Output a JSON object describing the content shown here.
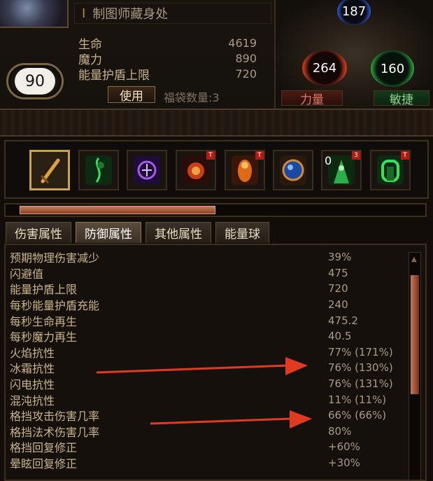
{
  "header": {
    "title": "制图师藏身处",
    "level": "90",
    "use_button": "使用",
    "bag_count": "福袋数量:3"
  },
  "stats": [
    {
      "label": "生命",
      "value": "4619"
    },
    {
      "label": "魔力",
      "value": "890"
    },
    {
      "label": "能量护盾上限",
      "value": "720"
    }
  ],
  "attributes": {
    "intelligence": "187",
    "strength": "264",
    "dexterity": "160",
    "strength_label": "力量",
    "dexterity_label": "敏捷"
  },
  "flasks": [
    {
      "name": "sword-icon",
      "color": "#d89a3a",
      "selected": true
    },
    {
      "name": "green-figure-icon",
      "color": "#2a9a3a"
    },
    {
      "name": "purple-rune-icon",
      "color": "#7a3ad0"
    },
    {
      "name": "fire-fist-icon",
      "color": "#d04a1a",
      "tag": "T"
    },
    {
      "name": "burning-figure-icon",
      "color": "#e0701a",
      "tag": "T"
    },
    {
      "name": "blue-orb-icon",
      "color": "#2a6ad0"
    },
    {
      "name": "green-aura-icon",
      "color": "#3ac04a",
      "count": "0"
    },
    {
      "name": "green-gate-icon",
      "color": "#2ab04a",
      "tag": "T"
    }
  ],
  "tabs": [
    {
      "label": "伤害属性",
      "active": false
    },
    {
      "label": "防御属性",
      "active": true
    },
    {
      "label": "其他属性",
      "active": false
    },
    {
      "label": "能量球",
      "active": false
    }
  ],
  "defense_stats": [
    {
      "label": "预期物理伤害减少",
      "value": "39%"
    },
    {
      "label": "闪避值",
      "value": "475"
    },
    {
      "label": "能量护盾上限",
      "value": "720"
    },
    {
      "label": "每秒能量护盾充能",
      "value": "240"
    },
    {
      "label": "每秒生命再生",
      "value": "475.2"
    },
    {
      "label": "每秒魔力再生",
      "value": "40.5"
    },
    {
      "label": "火焰抗性",
      "value": "77% (171%)"
    },
    {
      "label": "冰霜抗性",
      "value": "76% (130%)"
    },
    {
      "label": "闪电抗性",
      "value": "76% (131%)"
    },
    {
      "label": "混沌抗性",
      "value": "11% (11%)"
    },
    {
      "label": "格挡攻击伤害几率",
      "value": "66% (66%)"
    },
    {
      "label": "格挡法术伤害几率",
      "value": "80%"
    },
    {
      "label": "格挡回复修正",
      "value": "+60%"
    },
    {
      "label": "晕眩回复修正",
      "value": "+30%"
    }
  ],
  "colors": {
    "accent": "#c9a256",
    "arrow": "#e03a20"
  }
}
